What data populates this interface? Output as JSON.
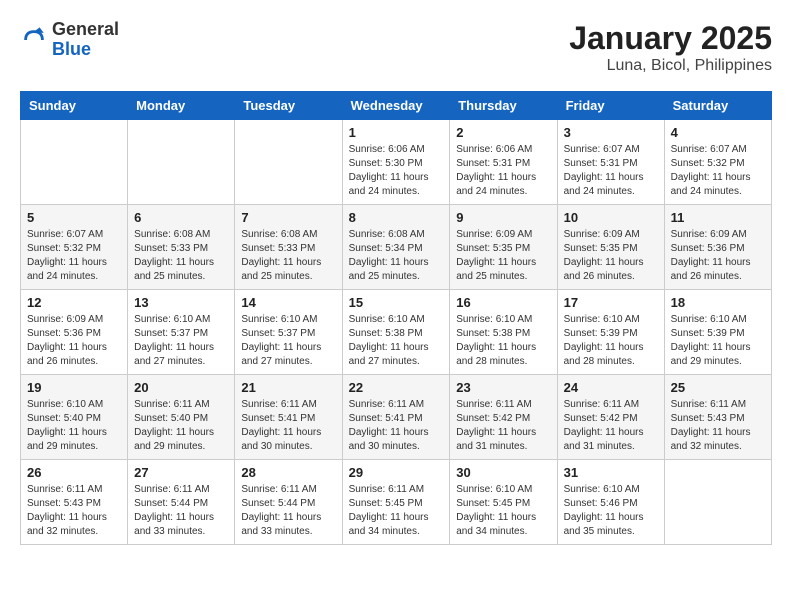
{
  "header": {
    "logo": {
      "line1": "General",
      "line2": "Blue"
    },
    "title": "January 2025",
    "subtitle": "Luna, Bicol, Philippines"
  },
  "weekdays": [
    "Sunday",
    "Monday",
    "Tuesday",
    "Wednesday",
    "Thursday",
    "Friday",
    "Saturday"
  ],
  "weeks": [
    [
      {
        "day": "",
        "sunrise": "",
        "sunset": "",
        "daylight": ""
      },
      {
        "day": "",
        "sunrise": "",
        "sunset": "",
        "daylight": ""
      },
      {
        "day": "",
        "sunrise": "",
        "sunset": "",
        "daylight": ""
      },
      {
        "day": "1",
        "sunrise": "Sunrise: 6:06 AM",
        "sunset": "Sunset: 5:30 PM",
        "daylight": "Daylight: 11 hours and 24 minutes."
      },
      {
        "day": "2",
        "sunrise": "Sunrise: 6:06 AM",
        "sunset": "Sunset: 5:31 PM",
        "daylight": "Daylight: 11 hours and 24 minutes."
      },
      {
        "day": "3",
        "sunrise": "Sunrise: 6:07 AM",
        "sunset": "Sunset: 5:31 PM",
        "daylight": "Daylight: 11 hours and 24 minutes."
      },
      {
        "day": "4",
        "sunrise": "Sunrise: 6:07 AM",
        "sunset": "Sunset: 5:32 PM",
        "daylight": "Daylight: 11 hours and 24 minutes."
      }
    ],
    [
      {
        "day": "5",
        "sunrise": "Sunrise: 6:07 AM",
        "sunset": "Sunset: 5:32 PM",
        "daylight": "Daylight: 11 hours and 24 minutes."
      },
      {
        "day": "6",
        "sunrise": "Sunrise: 6:08 AM",
        "sunset": "Sunset: 5:33 PM",
        "daylight": "Daylight: 11 hours and 25 minutes."
      },
      {
        "day": "7",
        "sunrise": "Sunrise: 6:08 AM",
        "sunset": "Sunset: 5:33 PM",
        "daylight": "Daylight: 11 hours and 25 minutes."
      },
      {
        "day": "8",
        "sunrise": "Sunrise: 6:08 AM",
        "sunset": "Sunset: 5:34 PM",
        "daylight": "Daylight: 11 hours and 25 minutes."
      },
      {
        "day": "9",
        "sunrise": "Sunrise: 6:09 AM",
        "sunset": "Sunset: 5:35 PM",
        "daylight": "Daylight: 11 hours and 25 minutes."
      },
      {
        "day": "10",
        "sunrise": "Sunrise: 6:09 AM",
        "sunset": "Sunset: 5:35 PM",
        "daylight": "Daylight: 11 hours and 26 minutes."
      },
      {
        "day": "11",
        "sunrise": "Sunrise: 6:09 AM",
        "sunset": "Sunset: 5:36 PM",
        "daylight": "Daylight: 11 hours and 26 minutes."
      }
    ],
    [
      {
        "day": "12",
        "sunrise": "Sunrise: 6:09 AM",
        "sunset": "Sunset: 5:36 PM",
        "daylight": "Daylight: 11 hours and 26 minutes."
      },
      {
        "day": "13",
        "sunrise": "Sunrise: 6:10 AM",
        "sunset": "Sunset: 5:37 PM",
        "daylight": "Daylight: 11 hours and 27 minutes."
      },
      {
        "day": "14",
        "sunrise": "Sunrise: 6:10 AM",
        "sunset": "Sunset: 5:37 PM",
        "daylight": "Daylight: 11 hours and 27 minutes."
      },
      {
        "day": "15",
        "sunrise": "Sunrise: 6:10 AM",
        "sunset": "Sunset: 5:38 PM",
        "daylight": "Daylight: 11 hours and 27 minutes."
      },
      {
        "day": "16",
        "sunrise": "Sunrise: 6:10 AM",
        "sunset": "Sunset: 5:38 PM",
        "daylight": "Daylight: 11 hours and 28 minutes."
      },
      {
        "day": "17",
        "sunrise": "Sunrise: 6:10 AM",
        "sunset": "Sunset: 5:39 PM",
        "daylight": "Daylight: 11 hours and 28 minutes."
      },
      {
        "day": "18",
        "sunrise": "Sunrise: 6:10 AM",
        "sunset": "Sunset: 5:39 PM",
        "daylight": "Daylight: 11 hours and 29 minutes."
      }
    ],
    [
      {
        "day": "19",
        "sunrise": "Sunrise: 6:10 AM",
        "sunset": "Sunset: 5:40 PM",
        "daylight": "Daylight: 11 hours and 29 minutes."
      },
      {
        "day": "20",
        "sunrise": "Sunrise: 6:11 AM",
        "sunset": "Sunset: 5:40 PM",
        "daylight": "Daylight: 11 hours and 29 minutes."
      },
      {
        "day": "21",
        "sunrise": "Sunrise: 6:11 AM",
        "sunset": "Sunset: 5:41 PM",
        "daylight": "Daylight: 11 hours and 30 minutes."
      },
      {
        "day": "22",
        "sunrise": "Sunrise: 6:11 AM",
        "sunset": "Sunset: 5:41 PM",
        "daylight": "Daylight: 11 hours and 30 minutes."
      },
      {
        "day": "23",
        "sunrise": "Sunrise: 6:11 AM",
        "sunset": "Sunset: 5:42 PM",
        "daylight": "Daylight: 11 hours and 31 minutes."
      },
      {
        "day": "24",
        "sunrise": "Sunrise: 6:11 AM",
        "sunset": "Sunset: 5:42 PM",
        "daylight": "Daylight: 11 hours and 31 minutes."
      },
      {
        "day": "25",
        "sunrise": "Sunrise: 6:11 AM",
        "sunset": "Sunset: 5:43 PM",
        "daylight": "Daylight: 11 hours and 32 minutes."
      }
    ],
    [
      {
        "day": "26",
        "sunrise": "Sunrise: 6:11 AM",
        "sunset": "Sunset: 5:43 PM",
        "daylight": "Daylight: 11 hours and 32 minutes."
      },
      {
        "day": "27",
        "sunrise": "Sunrise: 6:11 AM",
        "sunset": "Sunset: 5:44 PM",
        "daylight": "Daylight: 11 hours and 33 minutes."
      },
      {
        "day": "28",
        "sunrise": "Sunrise: 6:11 AM",
        "sunset": "Sunset: 5:44 PM",
        "daylight": "Daylight: 11 hours and 33 minutes."
      },
      {
        "day": "29",
        "sunrise": "Sunrise: 6:11 AM",
        "sunset": "Sunset: 5:45 PM",
        "daylight": "Daylight: 11 hours and 34 minutes."
      },
      {
        "day": "30",
        "sunrise": "Sunrise: 6:10 AM",
        "sunset": "Sunset: 5:45 PM",
        "daylight": "Daylight: 11 hours and 34 minutes."
      },
      {
        "day": "31",
        "sunrise": "Sunrise: 6:10 AM",
        "sunset": "Sunset: 5:46 PM",
        "daylight": "Daylight: 11 hours and 35 minutes."
      },
      {
        "day": "",
        "sunrise": "",
        "sunset": "",
        "daylight": ""
      }
    ]
  ]
}
